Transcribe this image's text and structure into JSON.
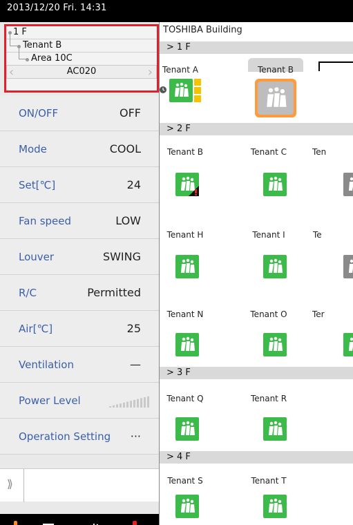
{
  "status_bar": {
    "datetime": "2013/12/20 Fri. 14:31"
  },
  "tree": {
    "floor": "1 F",
    "tenant": "Tenant B",
    "area": "Area 10C",
    "unit": "AC020",
    "prev_icon": "chevron-left-icon",
    "next_icon": "chevron-right-icon"
  },
  "properties": [
    {
      "name": "ON/OFF",
      "value": "OFF"
    },
    {
      "name": "Mode",
      "value": "COOL"
    },
    {
      "name": "Set[℃]",
      "value": "24"
    },
    {
      "name": "Fan speed",
      "value": "LOW"
    },
    {
      "name": "Louver",
      "value": "SWING"
    },
    {
      "name": "R/C",
      "value": "Permitted"
    },
    {
      "name": "Air[℃]",
      "value": "25"
    },
    {
      "name": "Ventilation",
      "value": "—"
    },
    {
      "name": "Power Level",
      "value": ""
    },
    {
      "name": "Operation Setting",
      "value": "···"
    }
  ],
  "expander": {
    "icon": "double-chevron-right-icon"
  },
  "bottom_bar": {
    "icons": [
      "hand-pointer-icon",
      "book-icon",
      "dotted-circle-icon",
      "exclamation-icon"
    ]
  },
  "main": {
    "building": "TOSHIBA Building",
    "floors": [
      {
        "label": "> 1 F"
      },
      {
        "label": "> 2 F"
      },
      {
        "label": "> 3 F"
      },
      {
        "label": "> 4 F"
      }
    ],
    "tenants": [
      "Tenant A",
      "Tenant B",
      "Tenant B",
      "Tenant C",
      "Ten",
      "Tenant H",
      "Tenant I",
      "Te",
      "Tenant N",
      "Tenant O",
      "Ter",
      "Tenant Q",
      "Tenant R",
      "Tenant S",
      "Tenant T"
    ]
  },
  "colors": {
    "accent_green": "#3cbb4a",
    "selection_orange": "#ff9a3d",
    "highlight_red": "#e0202a",
    "label_blue": "#3a5fa8"
  }
}
